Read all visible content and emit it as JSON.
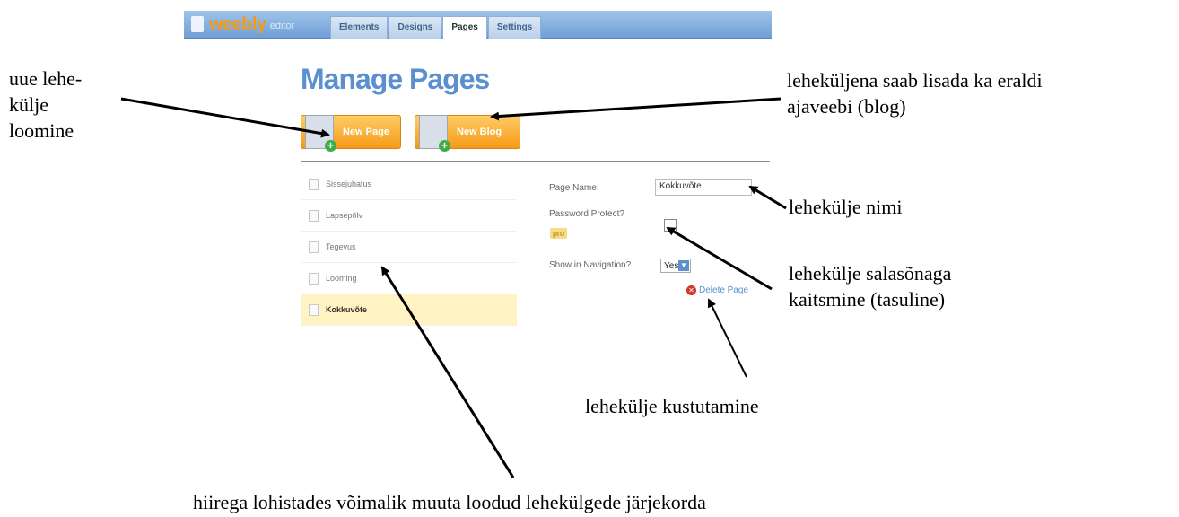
{
  "editor": {
    "logo": "weebly",
    "logo_suffix": "editor",
    "tabs": [
      "Elements",
      "Designs",
      "Pages",
      "Settings"
    ],
    "active_tab": "Pages"
  },
  "manage": {
    "title": "Manage Pages",
    "new_page_label": "New Page",
    "new_blog_label": "New Blog",
    "pages": [
      "Sissejuhatus",
      "Lapsepõlv",
      "Tegevus",
      "Looming",
      "Kokkuvõte"
    ],
    "selected_page": "Kokkuvõte",
    "page_name_label": "Page Name:",
    "page_name_value": "Kokkuvõte",
    "password_label": "Password Protect?",
    "pro_badge": "pro",
    "show_nav_label": "Show in Navigation?",
    "show_nav_value": "Yes",
    "delete_label": "Delete Page"
  },
  "annotations": {
    "new_page_line1": "uue lehe-",
    "new_page_line2": "külje",
    "new_page_line3": "loomine",
    "blog_line1": "leheküljena saab lisada ka eraldi",
    "blog_line2": "ajaveebi (blog)",
    "page_name": "lehekülje nimi",
    "password_line1": "lehekülje salasõnaga",
    "password_line2": "kaitsmine (tasuline)",
    "delete": "lehekülje kustutamine",
    "reorder": "hiirega lohistades võimalik muuta loodud lehekülgede järjekorda"
  }
}
